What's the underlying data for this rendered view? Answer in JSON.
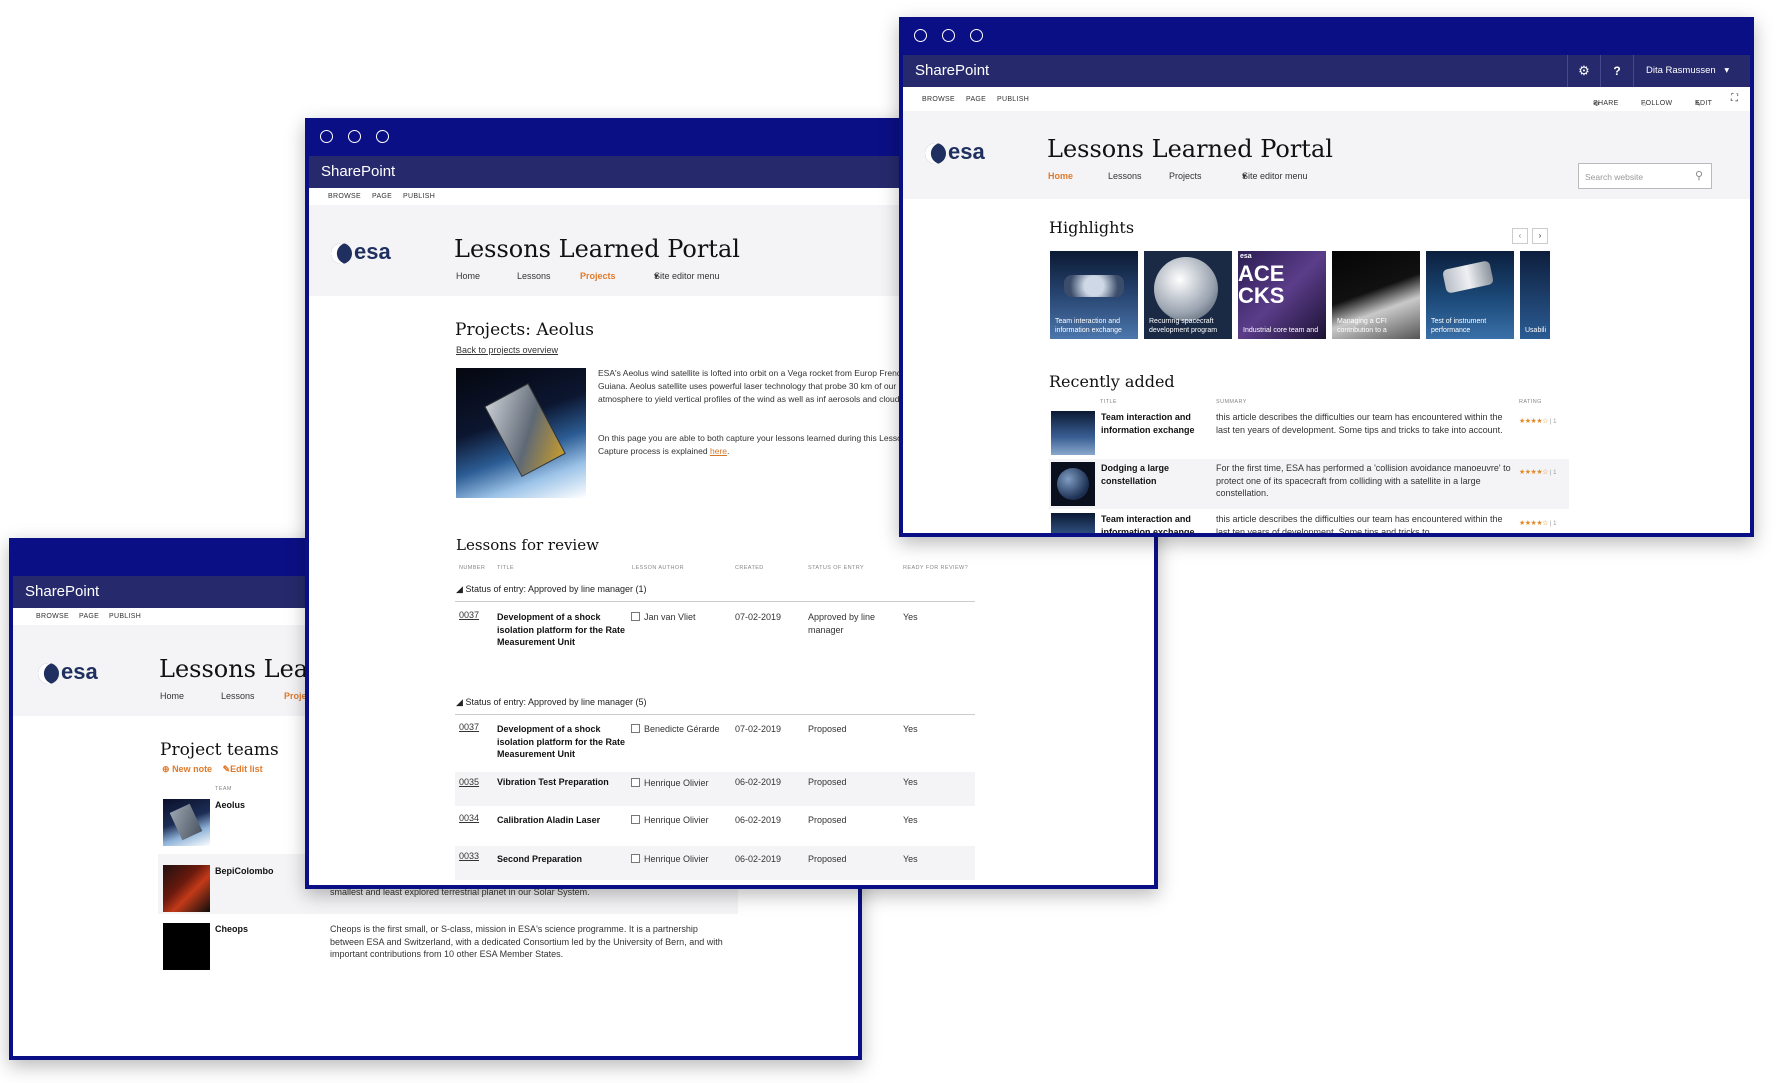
{
  "brand": {
    "app_name": "SharePoint",
    "logo_text": "esa",
    "portal_title": "Lessons Learned Portal",
    "accent": "#e07a2b",
    "frame": "#0b0f85",
    "suitebar": "#262a6d"
  },
  "ribbon": [
    "BROWSE",
    "PAGE",
    "PUBLISH"
  ],
  "nav": {
    "home": "Home",
    "lessons": "Lessons",
    "projects": "Projects",
    "site_editor": "Site editor menu"
  },
  "front": {
    "user": "Dita Rasmussen",
    "actions": {
      "share": "SHARE",
      "follow": "FOLLOW",
      "edit": "EDIT"
    },
    "search_placeholder": "Search website",
    "highlights_title": "Highlights",
    "highlights": [
      {
        "caption": "Team interaction and information exchange"
      },
      {
        "caption": "Recurring spacecraft development program"
      },
      {
        "caption": "Industrial core team and"
      },
      {
        "caption": "Managing a CFI contribution to a"
      },
      {
        "caption": "Test of instrument performance"
      },
      {
        "caption": "Usability"
      }
    ],
    "highlight_bg_text": "ACE CKS",
    "highlight_badge": "esa",
    "recent_title": "Recently added",
    "recent_cols": {
      "title": "TITLE",
      "summary": "SUMMARY",
      "rating": "RATING"
    },
    "recent": [
      {
        "title": "Team interaction and information exchange",
        "summary": "this article describes the difficulties our team has encountered within the last ten years of development. Some tips and tricks to take into account.",
        "stars": "★★★★☆",
        "count": "| 1"
      },
      {
        "title": "Dodging a large constellation",
        "summary": "For the first time, ESA has performed a 'collision avoidance manoeuvre' to protect one of its spacecraft from colliding with a satellite in a large constellation.",
        "stars": "★★★★☆",
        "count": "| 1"
      },
      {
        "title": "Team interaction and information exchange",
        "summary": "this article describes the difficulties our team has encountered within the last ten years of development. Some tips and tricks to",
        "stars": "★★★★☆",
        "count": "| 1"
      }
    ]
  },
  "middle": {
    "page_title": "Projects: Aeolus",
    "back_link": "Back to projects overview",
    "desc1": "ESA's Aeolus wind satellite is lofted into orbit on a Vega rocket from Europ French Guiana. Aeolus satellite uses powerful laser technology that probe 30 km of our atmosphere to yield vertical profiles of the wind as well as inf aerosols and clouds.",
    "desc2_pre": "On this page you are able to both capture your lessons learned during this Lesson Capture process is explained ",
    "desc2_link": "here",
    "desc2_post": ".",
    "lessons_title": "Lessons for review",
    "cols": {
      "number": "NUMBER",
      "title": "TITLE",
      "author": "LESSON AUTHOR",
      "created": "CREATED",
      "status": "STATUS OF ENTRY",
      "ready": "READY FOR REVIEW?"
    },
    "group1": "Status of entry: Approved by line manager (1)",
    "group2": "Status of entry: Approved by line manager (5)",
    "rows1": [
      {
        "number": "0037",
        "title": "Development of a shock isolation platform for the Rate Measurement Unit",
        "author": "Jan van Vliet",
        "created": "07-02-2019",
        "status": "Approved by line manager",
        "ready": "Yes"
      }
    ],
    "rows2": [
      {
        "number": "0037",
        "title": "Development of a shock isolation platform for the Rate Measurement Unit",
        "author": "Benedicte Gérarde",
        "created": "07-02-2019",
        "status": "Proposed",
        "ready": "Yes"
      },
      {
        "number": "0035",
        "title": "Vibration Test Preparation",
        "author": "Henrique Olivier",
        "created": "06-02-2019",
        "status": "Proposed",
        "ready": "Yes"
      },
      {
        "number": "0034",
        "title": "Calibration Aladin Laser",
        "author": "Henrique Olivier",
        "created": "06-02-2019",
        "status": "Proposed",
        "ready": "Yes"
      },
      {
        "number": "0033",
        "title": "Second Preparation",
        "author": "Henrique Olivier",
        "created": "06-02-2019",
        "status": "Proposed",
        "ready": "Yes"
      }
    ]
  },
  "back": {
    "portal_title_visible": "Lessons Learn",
    "nav_projects_visible": "Proje",
    "section_title": "Project teams",
    "new_note": "New note",
    "edit_list": "Edit list",
    "col_team": "TEAM",
    "teams": [
      {
        "name": "Aeolus",
        "desc": ""
      },
      {
        "name": "BepiColombo",
        "desc": "smallest and least explored terrestrial planet in our Solar System."
      },
      {
        "name": "Cheops",
        "desc": "Cheops is the first small, or S-class, mission in ESA's science programme. It is a partnership between ESA and Switzerland, with a dedicated Consortium led by the University of Bern, and with important contributions from 10 other ESA Member States."
      }
    ]
  }
}
